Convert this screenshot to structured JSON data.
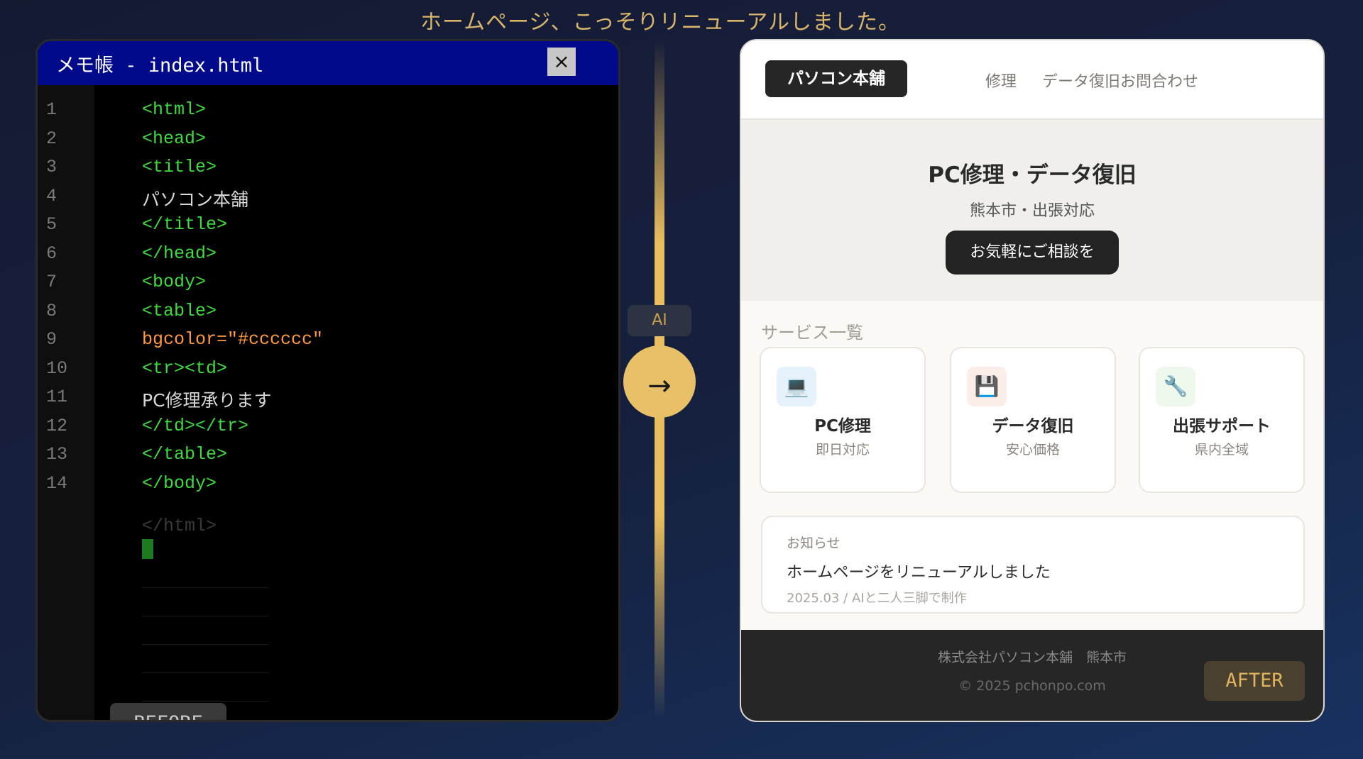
{
  "headline": "ホームページ、こっそりリニューアルしました。",
  "editor": {
    "title": "メモ帳 - index.html",
    "close_glyph": "×",
    "lines": [
      {
        "n": "1",
        "text": "<html>",
        "kind": "tag"
      },
      {
        "n": "2",
        "text": "<head>",
        "kind": "tag"
      },
      {
        "n": "3",
        "text": "<title>",
        "kind": "tag"
      },
      {
        "n": "4",
        "text": "パソコン本舗",
        "kind": "text"
      },
      {
        "n": "5",
        "text": "</title>",
        "kind": "tag"
      },
      {
        "n": "6",
        "text": "</head>",
        "kind": "tag"
      },
      {
        "n": "7",
        "text": "<body>",
        "kind": "tag"
      },
      {
        "n": "8",
        "text": "<table>",
        "kind": "tag"
      },
      {
        "n": "9",
        "text": "bgcolor=\"#cccccc\"",
        "kind": "attr"
      },
      {
        "n": "10",
        "text": "<tr><td>",
        "kind": "tag"
      },
      {
        "n": "11",
        "text": "PC修理承ります",
        "kind": "text"
      },
      {
        "n": "12",
        "text": "</td></tr>",
        "kind": "tag"
      },
      {
        "n": "13",
        "text": "</table>",
        "kind": "tag"
      },
      {
        "n": "14",
        "text": "</body>",
        "kind": "tag"
      }
    ],
    "ghost_line": "</html>",
    "badge": "BEFORE"
  },
  "divider": {
    "chip": "AI",
    "arrow": "→"
  },
  "site": {
    "logo": "パソコン本舗",
    "nav": [
      "修理",
      "データ復旧",
      "お問合わせ"
    ],
    "hero": {
      "title": "PC修理・データ復旧",
      "subtitle": "熊本市・出張対応",
      "cta": "お気軽にご相談を"
    },
    "services_label": "サービス一覧",
    "services": [
      {
        "icon": "💻",
        "name": "PC修理",
        "desc": "即日対応",
        "tint": "#e6f2fb"
      },
      {
        "icon": "💾",
        "name": "データ復旧",
        "desc": "安心価格",
        "tint": "#fbeee8"
      },
      {
        "icon": "🔧",
        "name": "出張サポート",
        "desc": "県内全域",
        "tint": "#eef8ec"
      }
    ],
    "news": {
      "label": "お知らせ",
      "headline": "ホームページをリニューアルしました",
      "meta": "2025.03 / AIと二人三脚で制作"
    },
    "footer": {
      "line1": "株式会社パソコン本舗　熊本市",
      "line2": "© 2025 pchonpo.com"
    },
    "badge": "AFTER"
  }
}
